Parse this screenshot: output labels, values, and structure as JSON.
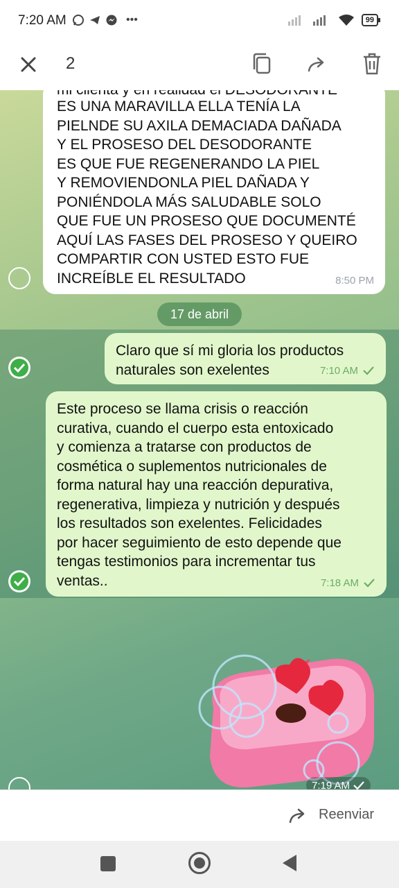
{
  "status_bar": {
    "time": "7:20 AM",
    "battery": "99"
  },
  "action_bar": {
    "selected_count": "2"
  },
  "messages": [
    {
      "first_line_partial": "mi clienta y en realidad el DESODORANTE",
      "text": "ES UNA MARAVILLA ELLA TENÍA LA\nPIELNDE SU AXILA DEMACIADA DAÑADA\nY EL PROSESO DEL DESODORANTE\nES QUE FUE REGENERANDO LA PIEL\nY REMOVIENDONLA PIEL DAÑADA Y\nPONIÉNDOLA MÁS SALUDABLE SOLO\nQUE FUE UN PROSESO QUE DOCUMENTÉ\nAQUÍ LAS FASES DEL PROSESO Y QUEIRO\nCOMPARTIR CON USTED ESTO FUE\nINCREÍBLE EL RESULTADO",
      "time": "8:50 PM"
    },
    {
      "text": "Claro que sí mi gloria los productos\nnaturales son exelentes",
      "time": "7:10 AM"
    },
    {
      "text": "Este proceso se llama crisis o reacción\ncurativa, cuando el cuerpo esta entoxicado\ny comienza a tratarse con productos de\ncosmética o suplementos nutricionales de\nforma natural hay una reacción depurativa,\nregenerativa, limpieza y nutrición y después\nlos resultados son exelentes. Felicidades\npor hacer seguimiento de esto depende que\ntengas testimonios para incrementar tus\nventas..",
      "time": "7:18 AM"
    }
  ],
  "date_separator": "17 de abril",
  "sticker": {
    "time": "7:19 AM"
  },
  "bottom_bar": {
    "forward_label": "Reenviar"
  },
  "colors": {
    "incoming_bubble": "#ffffff",
    "outgoing_bubble": "#e1f7cb",
    "check_green": "#6dac65",
    "select_green": "#3fae48"
  }
}
